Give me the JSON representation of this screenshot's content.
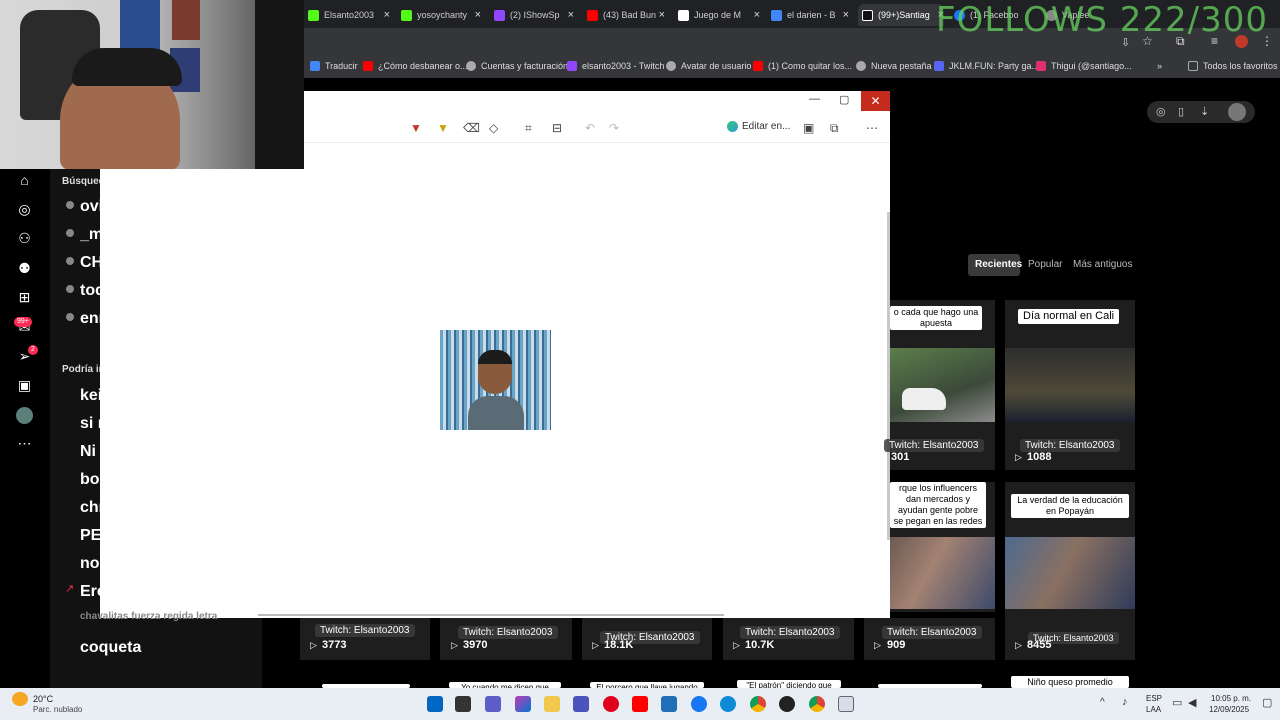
{
  "overlay": {
    "follows": "FOLLOWS 222/300"
  },
  "tabs": [
    {
      "label": "Elsanto2003",
      "color": "#53fc18"
    },
    {
      "label": "yosoychanty",
      "color": "#53fc18"
    },
    {
      "label": "(2) IShowSp",
      "color": "#9146ff"
    },
    {
      "label": "(43) Bad Bun",
      "color": "#ff0000"
    },
    {
      "label": "Juego de M",
      "color": "#ffffff"
    },
    {
      "label": "el darien - B",
      "color": "#4285f4"
    },
    {
      "label": "(99+)Santiag",
      "color": "#111111"
    },
    {
      "label": "(1) Faceboo",
      "color": "#1877f2"
    },
    {
      "label": "Vaplee",
      "color": "#888888"
    }
  ],
  "bookmarks": [
    {
      "label": "Traducir",
      "color": "#4285f4"
    },
    {
      "label": "¿Cómo desbanear o...",
      "color": "#ff0000"
    },
    {
      "label": "Cuentas y facturación",
      "color": "#aaaaaa"
    },
    {
      "label": "elsanto2003 - Twitch",
      "color": "#9146ff"
    },
    {
      "label": "Avatar de usuario",
      "color": "#aaaaaa"
    },
    {
      "label": "(1) Como quitar los...",
      "color": "#ff0000"
    },
    {
      "label": "Nueva pestaña",
      "color": "#aaaaaa"
    },
    {
      "label": "JKLM.FUN: Party ga...",
      "color": "#5865f2"
    },
    {
      "label": "Thigui (@santiago...",
      "color": "#e1306c"
    },
    {
      "label": "Todos los favoritos",
      "color": "#888888"
    }
  ],
  "viewer": {
    "edit_label": "Editar en..."
  },
  "sidebar": {
    "badge_inbox": "99+",
    "badge_send": "2"
  },
  "search": {
    "heading": "Búsqued",
    "recent": [
      "ovi v",
      "_mu",
      "CHU",
      "toda",
      "enri"
    ],
    "suggest_heading": "Podría in",
    "suggestions": [
      "keid",
      "si m",
      "Ni d",
      "box",
      "chri",
      "PER",
      "no e",
      "Eres",
      "chavalitas fuerza regida letra",
      "coqueta"
    ]
  },
  "filters": {
    "recent": "Recientes",
    "popular": "Popular",
    "oldest": "Más antiguos"
  },
  "videos_right": [
    {
      "caption": "o cada que hago una apuesta",
      "channel": "Twitch: Elsanto2003",
      "views": "301"
    },
    {
      "caption": "Día normal en Cali",
      "channel": "Twitch: Elsanto2003",
      "views": "1088"
    },
    {
      "caption": "rque los influencers dan mercados y ayudan gente pobre se pegan en las redes",
      "channel": "",
      "views": ""
    },
    {
      "caption": "La verdad de la educación en Popayán",
      "channel": "",
      "views": ""
    }
  ],
  "videos_bottom": [
    {
      "channel": "Twitch: Elsanto2003",
      "views": "3773"
    },
    {
      "channel": "Twitch: Elsanto2003",
      "views": "3970"
    },
    {
      "channel": "Twitch: Elsanto2003",
      "views": "18.1K"
    },
    {
      "channel": "Twitch: Elsanto2003",
      "views": "10.7K"
    },
    {
      "channel": "Twitch: Elsanto2003",
      "views": "909"
    },
    {
      "channel": "Twitch: Elsanto2003",
      "views": "8455"
    }
  ],
  "captions_bottom": [
    "Yo cuando me dicen que",
    "El porcero que llave jugando",
    "\"El patrón\" diciendo que",
    "Niño queso promedio cuando"
  ],
  "taskbar": {
    "temp": "20°C",
    "weather": "Parc. nublado",
    "lang1": "ESP",
    "lang2": "LAA",
    "time": "10:05 p. m.",
    "date": "12/09/2025"
  }
}
